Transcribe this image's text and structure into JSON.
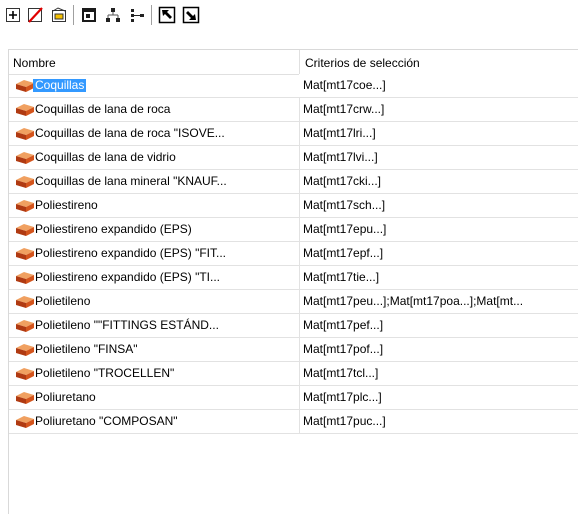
{
  "columns": {
    "name": "Nombre",
    "criteria": "Criterios de selección"
  },
  "selected_index": 0,
  "accent_color": "#3399ff",
  "toolbar": {
    "buttons": [
      "add-icon",
      "delete-icon",
      "edit-icon",
      "view-icon",
      "tree-icon",
      "expand-icon",
      "move-up-icon",
      "move-down-icon"
    ]
  },
  "rows": [
    {
      "name": "Coquillas",
      "criteria": "Mat[mt17coe...]"
    },
    {
      "name": "Coquillas de lana de roca",
      "criteria": "Mat[mt17crw...]"
    },
    {
      "name": "Coquillas de lana de roca \"ISOVE...",
      "criteria": "Mat[mt17lri...]"
    },
    {
      "name": "Coquillas de lana de vidrio",
      "criteria": "Mat[mt17lvi...]"
    },
    {
      "name": "Coquillas de lana mineral \"KNAUF...",
      "criteria": "Mat[mt17cki...]"
    },
    {
      "name": "Poliestireno",
      "criteria": "Mat[mt17sch...]"
    },
    {
      "name": "Poliestireno expandido (EPS)",
      "criteria": "Mat[mt17epu...]"
    },
    {
      "name": "Poliestireno expandido (EPS) \"FIT...",
      "criteria": "Mat[mt17epf...]"
    },
    {
      "name": "Poliestireno expandido (EPS) \"TI...",
      "criteria": "Mat[mt17tie...]"
    },
    {
      "name": "Polietileno",
      "criteria": "Mat[mt17peu...];Mat[mt17poa...];Mat[mt..."
    },
    {
      "name": "Polietileno \"\"FITTINGS ESTÁND...",
      "criteria": "Mat[mt17pef...]"
    },
    {
      "name": "Polietileno \"FINSA\"",
      "criteria": "Mat[mt17pof...]"
    },
    {
      "name": "Polietileno \"TROCELLEN\"",
      "criteria": "Mat[mt17tcl...]"
    },
    {
      "name": "Poliuretano",
      "criteria": "Mat[mt17plc...]"
    },
    {
      "name": "Poliuretano \"COMPOSAN\"",
      "criteria": "Mat[mt17puc...]"
    }
  ]
}
